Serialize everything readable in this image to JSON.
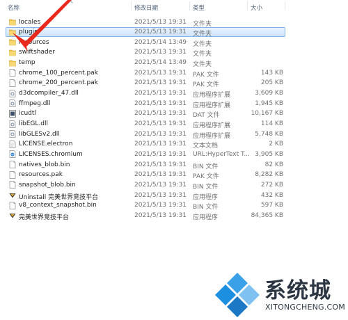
{
  "header": {
    "name": "名称",
    "date": "修改日期",
    "type": "类型",
    "size": "大小"
  },
  "files": [
    {
      "name": "locales",
      "date": "2021/5/13 19:31",
      "type": "文件夹",
      "size": "",
      "icon": "folder-icon"
    },
    {
      "name": "plugin",
      "date": "2021/5/13 19:31",
      "type": "文件夹",
      "size": "",
      "icon": "folder-icon",
      "selected": true
    },
    {
      "name": "resources",
      "date": "2021/5/14 13:49",
      "type": "文件夹",
      "size": "",
      "icon": "folder-icon"
    },
    {
      "name": "swiftshader",
      "date": "2021/5/13 19:31",
      "type": "文件夹",
      "size": "",
      "icon": "folder-icon"
    },
    {
      "name": "temp",
      "date": "2021/5/14 13:49",
      "type": "文件夹",
      "size": "",
      "icon": "folder-icon"
    },
    {
      "name": "chrome_100_percent.pak",
      "date": "2021/5/13 19:31",
      "type": "PAK 文件",
      "size": "143 KB",
      "icon": "file-icon"
    },
    {
      "name": "chrome_200_percent.pak",
      "date": "2021/5/13 19:31",
      "type": "PAK 文件",
      "size": "205 KB",
      "icon": "file-icon"
    },
    {
      "name": "d3dcompiler_47.dll",
      "date": "2021/5/13 19:31",
      "type": "应用程序扩展",
      "size": "3,609 KB",
      "icon": "dll-icon"
    },
    {
      "name": "ffmpeg.dll",
      "date": "2021/5/13 19:31",
      "type": "应用程序扩展",
      "size": "1,945 KB",
      "icon": "dll-icon"
    },
    {
      "name": "icudtl",
      "date": "2021/5/13 19:31",
      "type": "DAT 文件",
      "size": "10,167 KB",
      "icon": "dat-icon"
    },
    {
      "name": "libEGL.dll",
      "date": "2021/5/13 19:31",
      "type": "应用程序扩展",
      "size": "114 KB",
      "icon": "dll-icon"
    },
    {
      "name": "libGLESv2.dll",
      "date": "2021/5/13 19:31",
      "type": "应用程序扩展",
      "size": "5,748 KB",
      "icon": "dll-icon"
    },
    {
      "name": "LICENSE.electron",
      "date": "2021/5/13 19:31",
      "type": "文本文档",
      "size": "2 KB",
      "icon": "text-icon"
    },
    {
      "name": "LICENSES.chromium",
      "date": "2021/5/13 19:31",
      "type": "URL:HyperText T...",
      "size": "3,905 KB",
      "icon": "browser-icon"
    },
    {
      "name": "natives_blob.bin",
      "date": "2021/5/13 19:31",
      "type": "BIN 文件",
      "size": "82 KB",
      "icon": "file-icon"
    },
    {
      "name": "resources.pak",
      "date": "2021/5/13 19:31",
      "type": "PAK 文件",
      "size": "8,282 KB",
      "icon": "file-icon"
    },
    {
      "name": "snapshot_blob.bin",
      "date": "2021/5/13 19:31",
      "type": "BIN 文件",
      "size": "272 KB",
      "icon": "file-icon"
    },
    {
      "name": "Uninstall 完美世界竞技平台",
      "date": "2021/5/13 19:31",
      "type": "应用程序",
      "size": "432 KB",
      "icon": "app-icon"
    },
    {
      "name": "v8_context_snapshot.bin",
      "date": "2021/5/13 19:31",
      "type": "BIN 文件",
      "size": "597 KB",
      "icon": "file-icon"
    },
    {
      "name": "完美世界竞技平台",
      "date": "2021/5/13 19:31",
      "type": "应用程序",
      "size": "84,365 KB",
      "icon": "app-icon"
    }
  ],
  "watermark": {
    "brand": "系统城",
    "url": "XITONGCHENG.COM"
  },
  "colors": {
    "selection": "#cfe5fb",
    "folder": "#f3c74e",
    "arrow": "#e8291c",
    "watermark_blue": "#1c8fe0"
  }
}
